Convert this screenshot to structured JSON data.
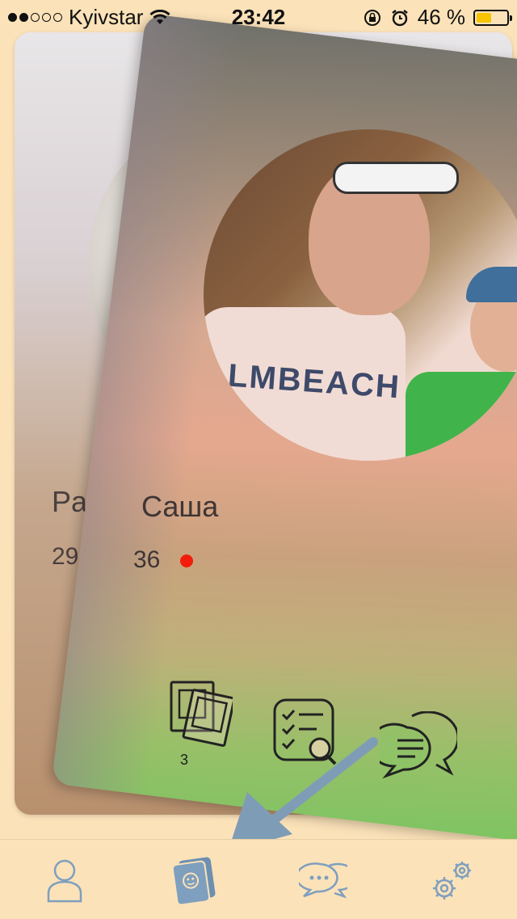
{
  "status_bar": {
    "carrier": "Kyivstar",
    "signal_bars": 2,
    "time": "23:42",
    "battery_percent": "46 %",
    "battery_level": 0.46
  },
  "back_card": {
    "name": "Pah",
    "age": "29"
  },
  "front_card": {
    "name": "Саша",
    "age": "36",
    "online": true,
    "photos_count": "3",
    "icons": [
      "photos-icon",
      "questionnaire-icon",
      "chat-icon"
    ]
  },
  "tab_bar": {
    "tabs": [
      {
        "icon": "profile-icon"
      },
      {
        "icon": "cards-icon",
        "active": true
      },
      {
        "icon": "messages-icon"
      },
      {
        "icon": "settings-icon"
      }
    ]
  },
  "colors": {
    "background": "#fbe2b9",
    "tab_icon": "#7e9fbe",
    "tab_active": "#6d8fb0",
    "online": "#f21c0a",
    "arrow": "#7f9cb7"
  }
}
